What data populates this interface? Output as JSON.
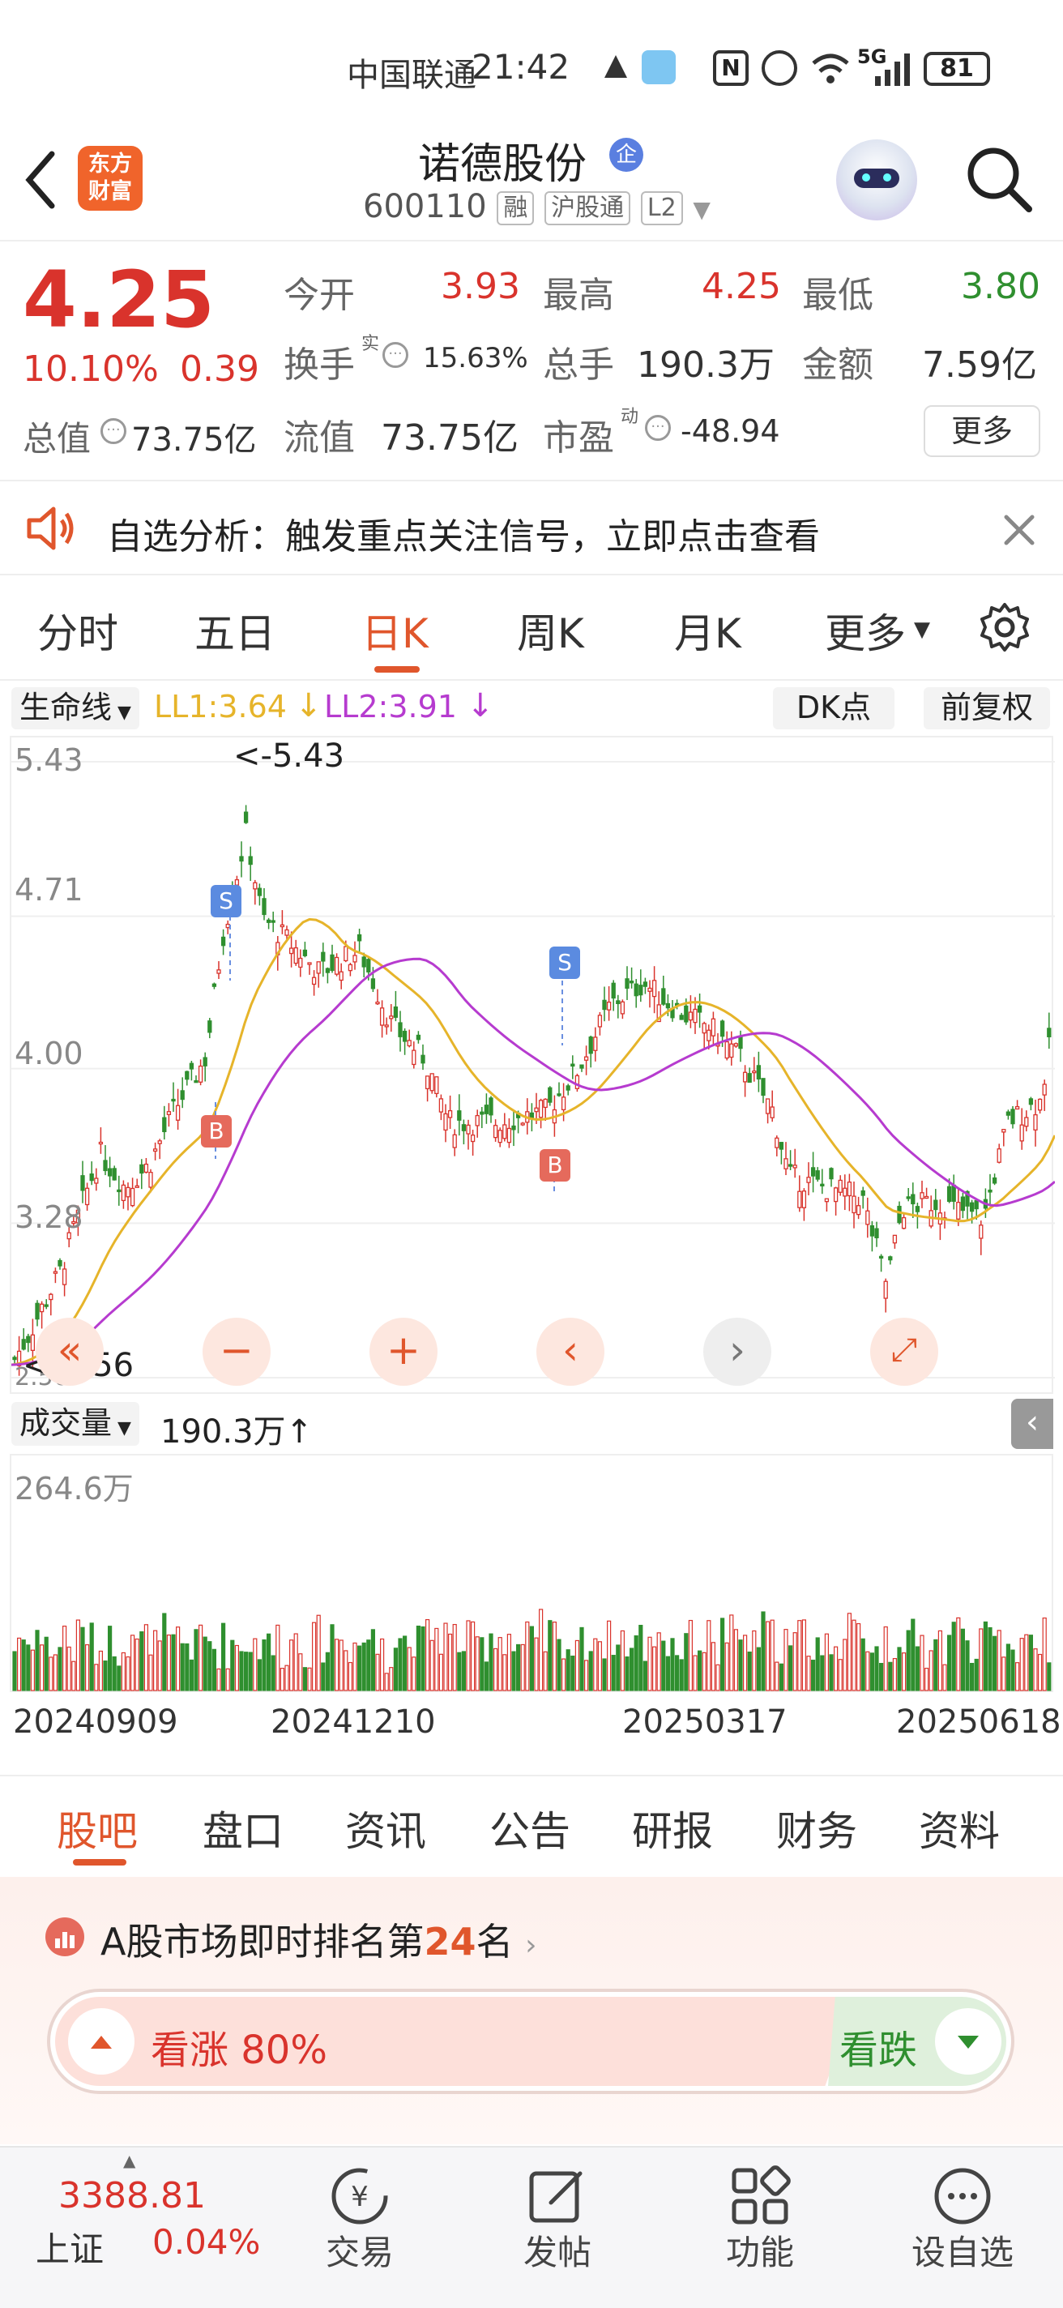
{
  "status_bar": {
    "carrier": "中国联通",
    "time": "21:42",
    "network": "5G",
    "battery": "81"
  },
  "header": {
    "name": "诺德股份",
    "badge": "企",
    "code": "600110",
    "tags": [
      "融",
      "沪股通",
      "L2"
    ],
    "logo_text": "东方\n财富",
    "logo_top": "东方",
    "logo_bottom": "财富"
  },
  "quote": {
    "price": "4.25",
    "change_pct": "10.10%",
    "change": "0.39",
    "fields": {
      "open_label": "今开",
      "open": "3.93",
      "high_label": "最高",
      "high": "4.25",
      "low_label": "最低",
      "low": "3.80",
      "turnover_label": "换手",
      "turnover_sup": "实",
      "turnover": "15.63%",
      "volume_label": "总手",
      "volume": "190.3万",
      "amount_label": "金额",
      "amount": "7.59亿",
      "mktcap_label": "总值",
      "mktcap": "73.75亿",
      "float_label": "流值",
      "float": "73.75亿",
      "pe_label": "市盈",
      "pe_sup": "动",
      "pe": "-48.94"
    },
    "more_label": "更多"
  },
  "banner": {
    "text": "自选分析：触发重点关注信号，立即点击查看"
  },
  "chart_tabs": {
    "items": [
      "分时",
      "五日",
      "日K",
      "周K",
      "月K",
      "更多"
    ],
    "active": "日K"
  },
  "chart_toolbar": {
    "indicator": "生命线",
    "ll1": "LL1:3.64",
    "ll2": "LL2:3.91",
    "dk_label": "DK点",
    "adjust_label": "前复权"
  },
  "kline": {
    "y_ticks": [
      "5.43",
      "4.71",
      "4.00",
      "3.28",
      "2.56"
    ],
    "high_marker": "<-5.43",
    "low_marker": "<-2.56",
    "signals": [
      "S",
      "B",
      "S",
      "B"
    ]
  },
  "volume_panel": {
    "label": "成交量",
    "value": "190.3万↑",
    "max_label": "264.6万"
  },
  "x_dates": [
    "20240909",
    "20241210",
    "20250317",
    "20250618"
  ],
  "chart_data": {
    "type": "bar",
    "title": "",
    "xlabel": "",
    "ylabel": "",
    "categories": [
      "20240909",
      "20241210",
      "20250317",
      "20250618"
    ],
    "y_axis_ticks": [
      5.43,
      4.71,
      4.0,
      3.28,
      2.56
    ],
    "series": [
      {
        "name": "LL1",
        "last": 3.64
      },
      {
        "name": "LL2",
        "last": 3.91
      }
    ],
    "volume_max": "264.6万",
    "grid": true
  },
  "bottom_tabs": {
    "items": [
      "股吧",
      "盘口",
      "资讯",
      "公告",
      "研报",
      "财务",
      "资料"
    ],
    "active": "股吧"
  },
  "ranking": {
    "prefix": "A股市场即时排名第",
    "rank": "24",
    "suffix": "名"
  },
  "sentiment": {
    "up_label": "看涨 80%",
    "down_label": "看跌",
    "up_pct": 80
  },
  "bottom_nav": {
    "index_value": "3388.81",
    "index_name": "上证",
    "index_change": "0.04%",
    "items": [
      "交易",
      "发帖",
      "功能",
      "设自选"
    ]
  }
}
